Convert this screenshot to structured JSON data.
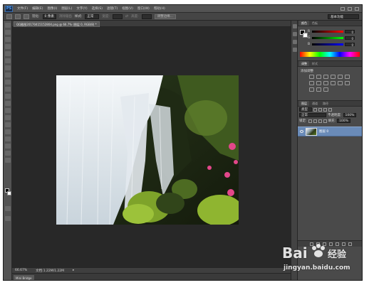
{
  "app": {
    "logo": "PS"
  },
  "menubar": {
    "items": [
      "文件(F)",
      "编辑(E)",
      "图像(I)",
      "图层(L)",
      "文字(Y)",
      "选择(S)",
      "滤镜(T)",
      "视图(V)",
      "窗口(W)",
      "帮助(H)"
    ]
  },
  "options_bar": {
    "feather_label": "羽化:",
    "feather_value": "0 像素",
    "antialias_label": "消除锯齿",
    "style_label": "样式:",
    "style_value": "正常",
    "width_label": "宽度:",
    "height_label": "高度:",
    "refine_edge_button": "调整边缘...",
    "workspace_value": "基本功能"
  },
  "document": {
    "tab_title": "QQ截图20170415152804.png @ 66.7% (图层 0, RGB/8) *",
    "zoom": "66.67%",
    "doc_info": "文档:1.22M/1.22M"
  },
  "mini_bridge": {
    "tab": "Mini Bridge"
  },
  "panels": {
    "color_tabs": [
      "颜色",
      "色板"
    ],
    "channels": [
      {
        "label": "R",
        "value": "0"
      },
      {
        "label": "G",
        "value": "0"
      },
      {
        "label": "B",
        "value": "0"
      }
    ],
    "adjust_tabs": [
      "调整",
      "样式"
    ],
    "adjust_title": "添加调整",
    "layer_tabs": [
      "图层",
      "通道",
      "路径"
    ],
    "kind_label": "类型",
    "blend_mode": "正常",
    "opacity_label": "不透明度:",
    "opacity_value": "100%",
    "lock_label": "锁定:",
    "fill_label": "填充:",
    "fill_value": "100%",
    "layer_name": "图层 0"
  },
  "watermark": {
    "brand_text": "Bai",
    "brand_suffix": "经验",
    "url": "jingyan.baidu.com"
  },
  "colors": {
    "accent": "#6a8bb8",
    "background": "#282828",
    "panel": "#4a4a4a"
  }
}
